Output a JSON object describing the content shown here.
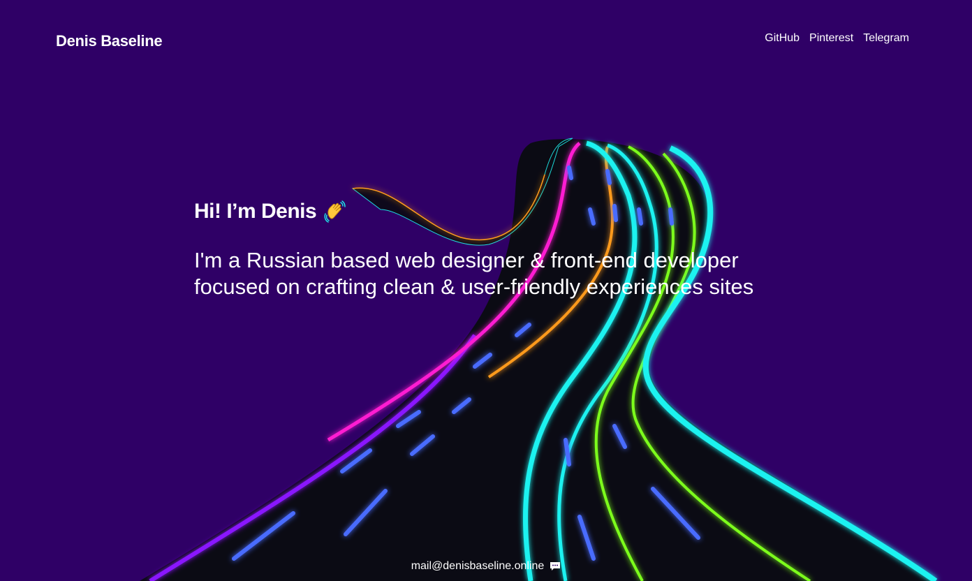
{
  "header": {
    "logo": "Denis Baseline",
    "nav": [
      "GitHub",
      "Pinterest",
      "Telegram"
    ]
  },
  "hero": {
    "heading": "Hi! I’m Denis",
    "heading_icon": "waving-hand-icon",
    "line1": "I'm a Russian based web designer & front-end developer",
    "line2": "focused on crafting clean & user-friendly experiences sites"
  },
  "footer": {
    "email": "mail@denisbaseline.online",
    "icon": "chat-bubble-icon"
  },
  "colors": {
    "background": "#2f0066",
    "road": "#0b0b14",
    "neon_cyan": "#1ef2f0",
    "neon_pink": "#ff1fd2",
    "neon_green": "#7dff1a",
    "neon_orange": "#ff9a1a",
    "neon_purple": "#8a17ff",
    "lane_blue": "#4a6cff"
  }
}
